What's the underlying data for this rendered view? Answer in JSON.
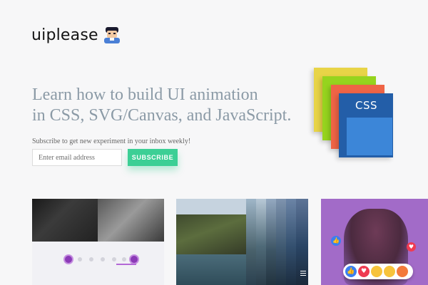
{
  "brand": {
    "name": "uiplease",
    "avatar_icon": "boy-avatar-icon"
  },
  "hero": {
    "headline_line1": "Learn how to build UI animation",
    "headline_line2": "in CSS, SVG/Canvas, and JavaScript.",
    "subscribe_text": "Subscribe to get new experiment in your inbox weekly!",
    "email_placeholder": "Enter email address",
    "subscribe_label": "SUBSCRIBE"
  },
  "stack": {
    "label": "CSS",
    "colors": [
      "#e8d447",
      "#96d41e",
      "#ef6446",
      "#235ea8"
    ]
  },
  "colors": {
    "headline": "#8b9aa6",
    "accent_green": "#3ccf95",
    "slider_purple": "#8b3ab7"
  },
  "thumbnails": [
    {
      "name": "cat-slider-experiment",
      "icons": [
        "cat-photo",
        "dots-slider"
      ]
    },
    {
      "name": "cliff-strips-experiment",
      "icons": [
        "cliff-photo",
        "menu-icon"
      ]
    },
    {
      "name": "reactions-experiment",
      "icons": [
        "like-icon",
        "love-icon",
        "haha-icon",
        "wow-icon",
        "angry-icon"
      ]
    }
  ]
}
